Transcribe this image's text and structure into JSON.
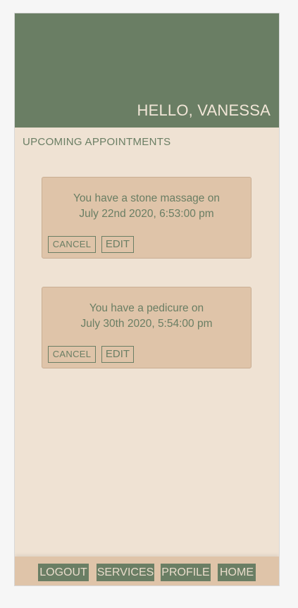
{
  "header": {
    "greeting": "HELLO, VANESSA"
  },
  "section": {
    "title": "UPCOMING APPOINTMENTS"
  },
  "appointments": [
    {
      "line1": "You have a stone massage on",
      "line2": "July 22nd 2020, 6:53:00 pm",
      "cancel_label": "CANCEL",
      "edit_label": "EDIT"
    },
    {
      "line1": "You have a pedicure on",
      "line2": "July 30th 2020, 5:54:00 pm",
      "cancel_label": "CANCEL",
      "edit_label": "EDIT"
    }
  ],
  "nav": {
    "logout": "LOGOUT",
    "services": "SERVICES",
    "profile": "PROFILE",
    "home": "HOME"
  },
  "colors": {
    "primary": "#6a7e64",
    "background": "#efe2d3",
    "card": "#dfc4a9"
  }
}
